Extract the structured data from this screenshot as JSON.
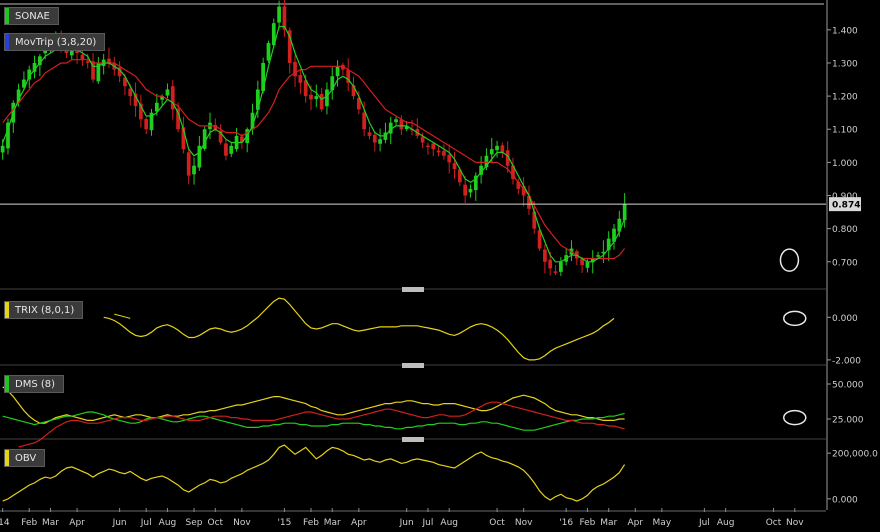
{
  "chart_data": {
    "type": "line",
    "price_panel": {
      "title": "SONAE",
      "indicator_label": "MovTrip (3,8,20)",
      "colors": {
        "up": "#1fcf1f",
        "down": "#d21f1f",
        "ma_fast": "#20cf20",
        "ma_slow": "#d31f1f"
      },
      "y_ticks": [
        "1.400",
        "1.300",
        "1.200",
        "1.100",
        "1.000",
        "0.900",
        "0.800",
        "0.700"
      ],
      "ylim": [
        0.63,
        1.49
      ],
      "last_price": "0.874",
      "weekly_close": [
        1.05,
        1.12,
        1.18,
        1.22,
        1.25,
        1.28,
        1.3,
        1.32,
        1.34,
        1.36,
        1.37,
        1.35,
        1.33,
        1.36,
        1.33,
        1.31,
        1.3,
        1.25,
        1.3,
        1.31,
        1.3,
        1.28,
        1.26,
        1.23,
        1.2,
        1.17,
        1.13,
        1.1,
        1.15,
        1.18,
        1.2,
        1.22,
        1.16,
        1.1,
        1.04,
        0.96,
        0.99,
        1.05,
        1.1,
        1.12,
        1.1,
        1.06,
        1.02,
        1.05,
        1.08,
        1.06,
        1.1,
        1.15,
        1.22,
        1.3,
        1.36,
        1.42,
        1.47,
        1.4,
        1.3,
        1.26,
        1.24,
        1.2,
        1.19,
        1.2,
        1.16,
        1.22,
        1.26,
        1.29,
        1.28,
        1.24,
        1.2,
        1.16,
        1.1,
        1.08,
        1.06,
        1.07,
        1.09,
        1.12,
        1.13,
        1.1,
        1.11,
        1.1,
        1.08,
        1.06,
        1.05,
        1.04,
        1.03,
        1.02,
        1.0,
        0.98,
        0.94,
        0.9,
        0.92,
        0.96,
        0.99,
        1.02,
        1.04,
        1.05,
        1.03,
        0.99,
        0.95,
        0.92,
        0.9,
        0.86,
        0.8,
        0.74,
        0.7,
        0.68,
        0.67,
        0.7,
        0.72,
        0.74,
        0.71,
        0.69,
        0.7,
        0.71,
        0.72,
        0.73,
        0.77,
        0.8,
        0.83,
        0.874
      ],
      "ma_fast": [
        1.06,
        1.1,
        1.15,
        1.19,
        1.22,
        1.26,
        1.28,
        1.3,
        1.32,
        1.33,
        1.34,
        1.34,
        1.34,
        1.35,
        1.34,
        1.33,
        1.32,
        1.29,
        1.29,
        1.3,
        1.3,
        1.29,
        1.28,
        1.26,
        1.23,
        1.2,
        1.17,
        1.14,
        1.14,
        1.15,
        1.17,
        1.19,
        1.18,
        1.15,
        1.1,
        1.04,
        1.02,
        1.03,
        1.06,
        1.09,
        1.1,
        1.09,
        1.07,
        1.06,
        1.06,
        1.06,
        1.08,
        1.11,
        1.16,
        1.22,
        1.29,
        1.35,
        1.41,
        1.41,
        1.38,
        1.33,
        1.29,
        1.25,
        1.22,
        1.21,
        1.19,
        1.2,
        1.22,
        1.25,
        1.26,
        1.25,
        1.23,
        1.2,
        1.16,
        1.12,
        1.09,
        1.08,
        1.08,
        1.1,
        1.11,
        1.11,
        1.11,
        1.1,
        1.09,
        1.08,
        1.07,
        1.06,
        1.05,
        1.04,
        1.03,
        1.01,
        0.98,
        0.95,
        0.94,
        0.95,
        0.97,
        0.99,
        1.01,
        1.03,
        1.03,
        1.02,
        0.99,
        0.96,
        0.93,
        0.9,
        0.85,
        0.8,
        0.76,
        0.72,
        0.7,
        0.7,
        0.71,
        0.72,
        0.72,
        0.71,
        0.7,
        0.7,
        0.71,
        0.72,
        0.74,
        0.76,
        0.79,
        0.83
      ],
      "ma_slow": [
        1.12,
        1.14,
        1.16,
        1.18,
        1.2,
        1.22,
        1.24,
        1.25,
        1.27,
        1.28,
        1.29,
        1.3,
        1.3,
        1.31,
        1.31,
        1.31,
        1.31,
        1.3,
        1.3,
        1.3,
        1.3,
        1.3,
        1.29,
        1.28,
        1.27,
        1.26,
        1.24,
        1.22,
        1.21,
        1.2,
        1.2,
        1.19,
        1.18,
        1.17,
        1.15,
        1.13,
        1.12,
        1.11,
        1.11,
        1.11,
        1.11,
        1.1,
        1.09,
        1.09,
        1.09,
        1.08,
        1.09,
        1.1,
        1.11,
        1.13,
        1.15,
        1.18,
        1.22,
        1.24,
        1.26,
        1.27,
        1.28,
        1.28,
        1.29,
        1.29,
        1.29,
        1.29,
        1.29,
        1.29,
        1.29,
        1.28,
        1.27,
        1.26,
        1.24,
        1.22,
        1.2,
        1.18,
        1.16,
        1.15,
        1.14,
        1.13,
        1.12,
        1.12,
        1.11,
        1.1,
        1.09,
        1.08,
        1.07,
        1.06,
        1.05,
        1.04,
        1.03,
        1.02,
        1.01,
        1.0,
        1.0,
        1.0,
        1.0,
        1.0,
        0.99,
        0.98,
        0.96,
        0.94,
        0.92,
        0.9,
        0.87,
        0.84,
        0.81,
        0.79,
        0.77,
        0.75,
        0.74,
        0.73,
        0.72,
        0.71,
        0.71,
        0.71,
        0.71,
        0.71,
        0.71,
        0.71,
        0.72,
        0.74
      ],
      "annotation": "circle"
    },
    "trix_panel": {
      "label": "TRIX (8,0,1)",
      "color": "#e5d21a",
      "y_ticks": [
        "0.000",
        "-2.000"
      ],
      "ylim": [
        -2.1,
        1.0
      ],
      "values": [
        null,
        null,
        null,
        null,
        null,
        null,
        null,
        null,
        null,
        null,
        null,
        null,
        null,
        null,
        null,
        null,
        null,
        null,
        null,
        0.0,
        -0.05,
        -0.15,
        -0.3,
        -0.5,
        -0.7,
        -0.85,
        -0.9,
        -0.85,
        -0.7,
        -0.5,
        -0.4,
        -0.35,
        -0.45,
        -0.6,
        -0.8,
        -0.95,
        -0.95,
        -0.85,
        -0.7,
        -0.55,
        -0.5,
        -0.55,
        -0.65,
        -0.7,
        -0.65,
        -0.55,
        -0.4,
        -0.2,
        0.0,
        0.25,
        0.5,
        0.75,
        0.9,
        0.85,
        0.6,
        0.3,
        0.0,
        -0.3,
        -0.5,
        -0.55,
        -0.5,
        -0.4,
        -0.3,
        -0.3,
        -0.4,
        -0.5,
        -0.6,
        -0.65,
        -0.6,
        -0.55,
        -0.5,
        -0.45,
        -0.45,
        -0.45,
        -0.45,
        -0.4,
        -0.4,
        -0.4,
        -0.4,
        -0.45,
        -0.5,
        -0.55,
        -0.6,
        -0.7,
        -0.8,
        -0.85,
        -0.75,
        -0.6,
        -0.45,
        -0.35,
        -0.3,
        -0.35,
        -0.45,
        -0.6,
        -0.8,
        -1.05,
        -1.35,
        -1.65,
        -1.9,
        -2.0,
        -2.0,
        -1.95,
        -1.8,
        -1.6,
        -1.45,
        -1.35,
        -1.25,
        -1.15,
        -1.05,
        -0.95,
        -0.85,
        -0.75,
        -0.6,
        -0.4,
        -0.25,
        -0.05
      ],
      "annotation": "circle"
    },
    "dms_panel": {
      "label": "DMS (8)",
      "series": [
        {
          "color": "#e5d21a",
          "values": [
            48,
            45,
            41,
            36,
            31,
            27,
            24,
            22,
            22,
            24,
            26,
            27,
            28,
            27,
            26,
            25,
            24,
            24,
            25,
            26,
            27,
            28,
            27,
            26,
            27,
            28,
            28,
            27,
            26,
            26,
            27,
            28,
            27,
            27,
            28,
            28,
            29,
            30,
            30,
            31,
            31,
            32,
            33,
            34,
            35,
            35,
            36,
            37,
            38,
            39,
            40,
            41,
            41,
            40,
            39,
            38,
            37,
            36,
            34,
            33,
            31,
            30,
            29,
            28,
            28,
            29,
            30,
            31,
            32,
            33,
            34,
            35,
            36,
            36,
            37,
            37,
            38,
            38,
            37,
            36,
            36,
            35,
            35,
            36,
            36,
            36,
            35,
            34,
            33,
            32,
            31,
            31,
            32,
            34,
            36,
            38,
            40,
            41,
            42,
            41,
            40,
            38,
            36,
            33,
            31,
            30,
            29,
            28,
            28,
            27,
            26,
            26,
            25,
            24,
            24,
            24,
            25,
            25
          ]
        },
        {
          "color": "#1fcf1f",
          "values": [
            27,
            26,
            25,
            24,
            23,
            22,
            21,
            22,
            23,
            24,
            25,
            26,
            27,
            27,
            28,
            29,
            30,
            30,
            29,
            28,
            26,
            25,
            24,
            23,
            22,
            22,
            23,
            25,
            26,
            26,
            25,
            24,
            23,
            23,
            24,
            25,
            26,
            27,
            27,
            26,
            25,
            24,
            23,
            22,
            21,
            20,
            19,
            19,
            19,
            20,
            20,
            21,
            21,
            22,
            22,
            22,
            21,
            21,
            20,
            20,
            20,
            20,
            21,
            21,
            22,
            22,
            22,
            22,
            21,
            21,
            20,
            20,
            19,
            19,
            18,
            18,
            19,
            19,
            20,
            20,
            21,
            21,
            22,
            22,
            22,
            22,
            21,
            21,
            22,
            22,
            23,
            23,
            22,
            22,
            21,
            20,
            19,
            18,
            17,
            17,
            17,
            18,
            19,
            20,
            21,
            22,
            23,
            24,
            24,
            25,
            25,
            25,
            26,
            26,
            27,
            27,
            28,
            29
          ]
        },
        {
          "color": "#d21f1f",
          "values": [
            null,
            null,
            null,
            5,
            6,
            7,
            8,
            10,
            13,
            16,
            19,
            21,
            23,
            24,
            24,
            23,
            22,
            22,
            22,
            23,
            24,
            25,
            26,
            26,
            26,
            25,
            24,
            24,
            25,
            26,
            26,
            27,
            27,
            26,
            25,
            24,
            24,
            24,
            25,
            26,
            27,
            27,
            27,
            26,
            26,
            25,
            25,
            24,
            24,
            24,
            24,
            24,
            25,
            26,
            27,
            28,
            29,
            30,
            30,
            29,
            28,
            27,
            26,
            25,
            25,
            25,
            26,
            27,
            28,
            29,
            30,
            31,
            32,
            32,
            31,
            30,
            29,
            28,
            27,
            26,
            26,
            27,
            28,
            28,
            27,
            27,
            27,
            28,
            30,
            32,
            34,
            36,
            37,
            37,
            36,
            35,
            34,
            33,
            32,
            31,
            30,
            29,
            28,
            27,
            26,
            25,
            24,
            24,
            23,
            22,
            22,
            22,
            21,
            21,
            20,
            20,
            19,
            18
          ]
        }
      ],
      "y_ticks": [
        "50.000",
        "25.000"
      ],
      "ylim": [
        15,
        60
      ],
      "annotation": "circle"
    },
    "obv_panel": {
      "label": "OBV",
      "color": "#e5d21a",
      "y_ticks": [
        "200,000.0",
        "0.000"
      ],
      "ylim": [
        -40000,
        240000
      ],
      "values": [
        -10000,
        0,
        15000,
        30000,
        45000,
        60000,
        70000,
        85000,
        95000,
        90000,
        100000,
        120000,
        135000,
        140000,
        130000,
        120000,
        110000,
        95000,
        110000,
        120000,
        130000,
        125000,
        115000,
        110000,
        120000,
        105000,
        90000,
        80000,
        90000,
        95000,
        100000,
        90000,
        75000,
        60000,
        40000,
        30000,
        45000,
        60000,
        70000,
        85000,
        80000,
        70000,
        75000,
        90000,
        100000,
        110000,
        125000,
        135000,
        145000,
        155000,
        170000,
        195000,
        225000,
        235000,
        215000,
        195000,
        210000,
        225000,
        200000,
        175000,
        190000,
        210000,
        225000,
        220000,
        210000,
        195000,
        190000,
        180000,
        170000,
        175000,
        165000,
        160000,
        170000,
        175000,
        165000,
        155000,
        160000,
        170000,
        175000,
        170000,
        165000,
        160000,
        150000,
        145000,
        140000,
        135000,
        150000,
        165000,
        180000,
        195000,
        205000,
        190000,
        180000,
        175000,
        165000,
        160000,
        150000,
        140000,
        125000,
        100000,
        70000,
        35000,
        10000,
        -5000,
        10000,
        20000,
        5000,
        0,
        -10000,
        0,
        15000,
        40000,
        55000,
        65000,
        80000,
        95000,
        115000,
        150000
      ]
    },
    "x_axis_labels": [
      "'14",
      "Feb",
      "Mar",
      "Apr",
      "Jun",
      "Jul",
      "Aug",
      "Sep",
      "Oct",
      "Nov",
      "'15",
      "Feb",
      "Mar",
      "Apr",
      "Jun",
      "Jul",
      "Aug",
      "Oct",
      "Nov",
      "'16",
      "Feb",
      "Mar",
      "Apr",
      "May",
      "Jul",
      "Aug",
      "Oct",
      "Nov"
    ],
    "x_label_weeks": [
      0,
      5,
      9,
      14,
      22,
      27,
      31,
      36,
      40,
      45,
      53,
      58,
      62,
      67,
      76,
      80,
      84,
      93,
      98,
      106,
      110,
      114,
      119,
      124,
      132,
      136,
      145,
      149
    ],
    "n_weeks": 155
  }
}
